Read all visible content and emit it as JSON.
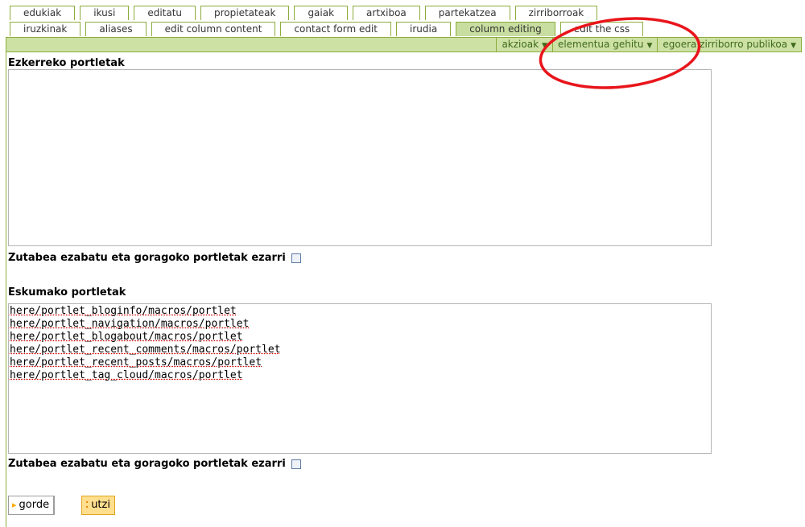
{
  "tabs_row1": [
    "edukiak",
    "ikusi",
    "editatu",
    "propietateak",
    "gaiak",
    "artxiboa",
    "partekatzea",
    "zirriborroak"
  ],
  "tabs_row2": [
    "iruzkinak",
    "aliases",
    "edit column content",
    "contact form edit",
    "irudia",
    "column editing",
    "edit the css"
  ],
  "active_tab": "column editing",
  "menus": [
    "akzioak",
    "elementua gehitu",
    "egoera zirriborro publikoa"
  ],
  "left_section": {
    "label": "Ezkerreko portletak",
    "lines": [],
    "checkbox_label": "Zutabea ezabatu eta goragoko portletak ezarri",
    "checked": false
  },
  "right_section": {
    "label": "Eskumako portletak",
    "lines": [
      "here/portlet_bloginfo/macros/portlet",
      "here/portlet_navigation/macros/portlet",
      "here/portlet_blogabout/macros/portlet",
      "here/portlet_recent_comments/macros/portlet",
      "here/portlet_recent_posts/macros/portlet",
      "here/portlet_tag_cloud/macros/portlet"
    ],
    "checkbox_label": "Zutabea ezabatu eta goragoko portletak ezarri",
    "checked": false
  },
  "buttons": {
    "save": "gorde",
    "cancel": "utzi"
  },
  "colors": {
    "accent_green": "#8cac3c",
    "bar_green": "#cde1a5",
    "annotation_red": "#e8151b",
    "cancel_bg": "#ffdf8e"
  }
}
